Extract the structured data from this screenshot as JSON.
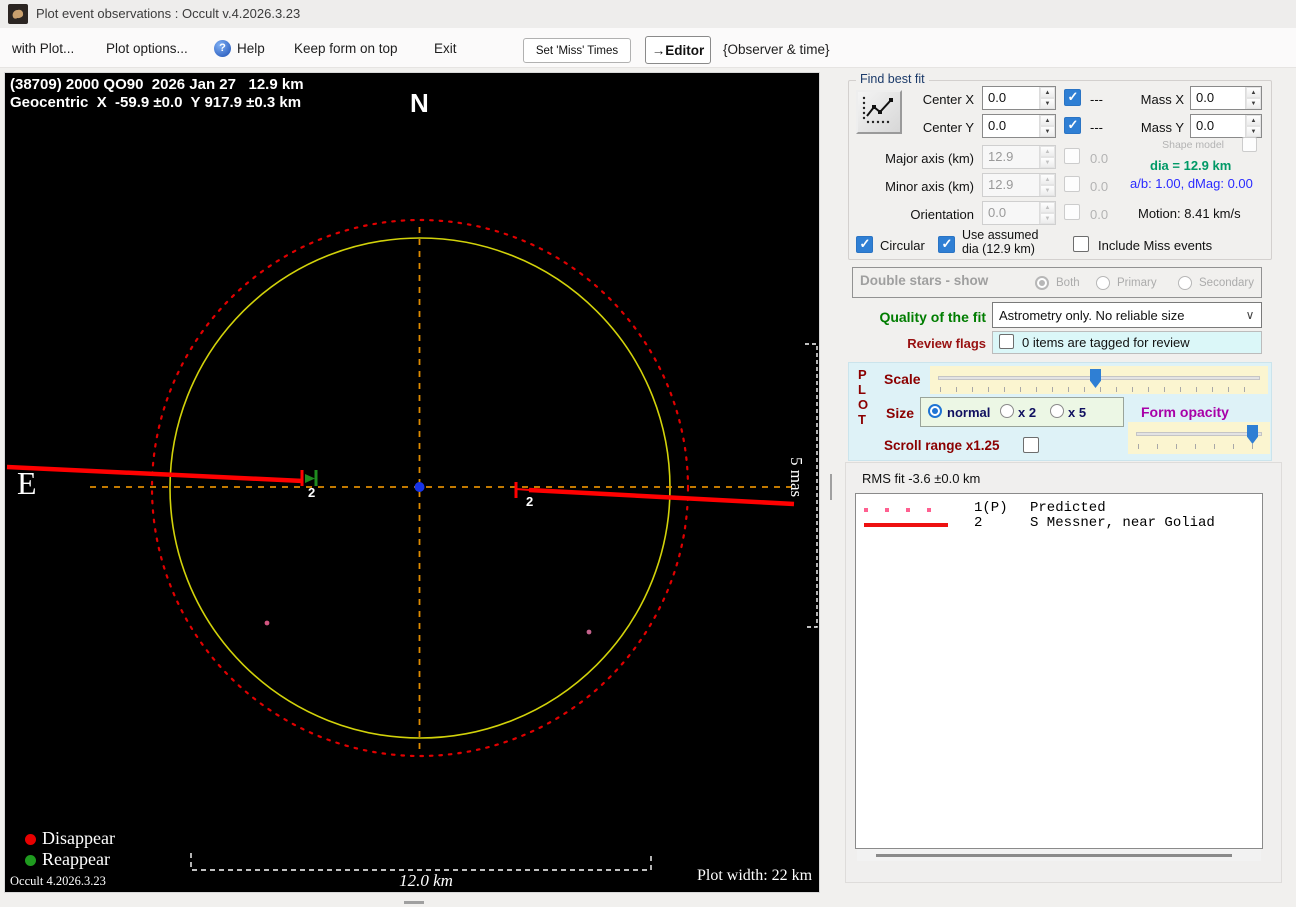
{
  "window": {
    "title": "Plot event observations : Occult v.4.2026.3.23"
  },
  "toolbar": {
    "with_plot": "with Plot...",
    "plot_options": "Plot options...",
    "help": "Help",
    "keep_form_on_top": "Keep form on top",
    "exit": "Exit",
    "set_miss_times": "Set 'Miss' Times",
    "editor": "→Editor",
    "observer_time": "{Observer & time}"
  },
  "icons": {
    "help_glyph": "?",
    "chevron_down": "∨"
  },
  "plot": {
    "header_line1": "(38709) 2000 QO90  2026 Jan 27   12.9 km",
    "header_line2": "Geocentric  X  -59.9 ±0.0  Y 917.9 ±0.3 km",
    "north": "N",
    "east": "E",
    "chord_label_left": "2",
    "chord_label_right": "2",
    "vertical_scale": "5 mas",
    "horizontal_scale": "12.0 km",
    "legend_disappear": "Disappear",
    "legend_reappear": "Reappear",
    "version": "Occult 4.2026.3.23",
    "plot_width": "Plot width: 22 km"
  },
  "find_best_fit": {
    "title": "Find best fit",
    "center_x": {
      "label": "Center X",
      "value": "0.0",
      "flag": "---"
    },
    "center_y": {
      "label": "Center Y",
      "value": "0.0",
      "flag": "---"
    },
    "mass_x": {
      "label": "Mass X",
      "value": "0.0"
    },
    "mass_y": {
      "label": "Mass Y",
      "value": "0.0"
    },
    "shape_model": "Shape model",
    "major_axis": {
      "label": "Major axis (km)",
      "value": "12.9",
      "flag": "0.0"
    },
    "minor_axis": {
      "label": "Minor axis (km)",
      "value": "12.9",
      "flag": "0.0"
    },
    "orientation": {
      "label": "Orientation",
      "value": "0.0",
      "flag": "0.0"
    },
    "dia": "dia = 12.9 km",
    "ab_dmag": "a/b: 1.00, dMag: 0.00",
    "motion": "Motion: 8.41 km/s",
    "circular": "Circular",
    "use_assumed_line1": "Use assumed",
    "use_assumed_line2": "dia (12.9 km)",
    "include_miss": "Include Miss events"
  },
  "double_stars": {
    "title": "Double stars - show",
    "options": [
      "Both",
      "Primary",
      "Secondary"
    ],
    "selected": "Both"
  },
  "quality_fit": {
    "label": "Quality of the fit",
    "value": "Astrometry only. No reliable size"
  },
  "review_flags": {
    "label": "Review flags",
    "value": "0 items are tagged for review"
  },
  "plot_controls": {
    "plot_letters": [
      "P",
      "L",
      "O",
      "T"
    ],
    "scale": "Scale",
    "size": "Size",
    "size_options": [
      "normal",
      "x 2",
      "x 5"
    ],
    "size_selected": "normal",
    "form_opacity": "Form opacity",
    "scroll_range": "Scroll range x1.25"
  },
  "rms": {
    "label": "RMS fit -3.6 ±0.0 km",
    "legend": [
      {
        "id": "1(P)",
        "name": "Predicted",
        "marker": "dotted-pink"
      },
      {
        "id": "2",
        "name": "S Messner, near Goliad",
        "marker": "solid-red"
      }
    ]
  },
  "colors": {
    "accent_blue": "#2f7fd4",
    "maroon_label": "#8b0000",
    "quality_green": "#007d00",
    "form_opacity_purple": "#a800a8",
    "dia_green": "#009966",
    "ab_blue": "#2a2aff",
    "chord_red": "#ff0000",
    "circle_yellow": "#d2d20a",
    "crosshair_orange": "#de8a00",
    "legend_pink": "#ff6090"
  }
}
